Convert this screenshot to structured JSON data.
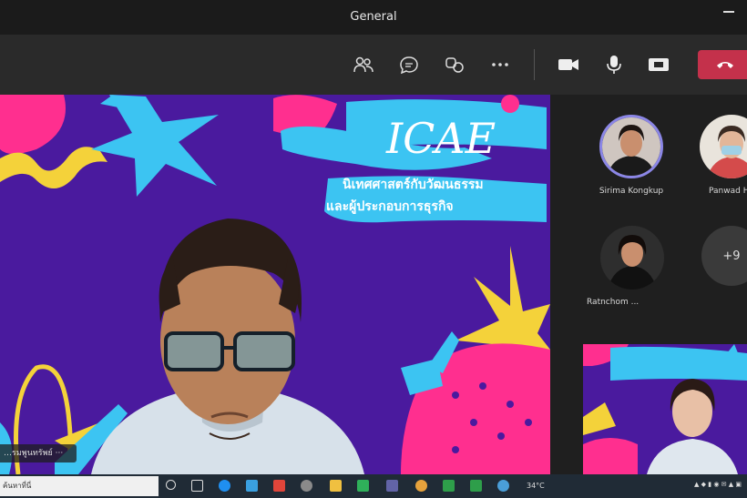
{
  "window": {
    "title": "General"
  },
  "toolbar": {
    "icons": [
      "people-icon",
      "chat-icon",
      "reactions-icon",
      "more-icon",
      "camera-icon",
      "mic-icon",
      "share-icon",
      "hang-up-icon"
    ]
  },
  "stage": {
    "slide_title": "ICAE",
    "slide_line1": "นิเทศศาสตร์กับวัฒนธรรม",
    "slide_line2": "และผู้ประกอบการธุรกิจ",
    "speaker_tag": "…รมพูนทรัพย์ ···",
    "colors": {
      "background": "#4a1a9e",
      "pink": "#ff2f8f",
      "cyan": "#3cc4f2",
      "yellow": "#f4d23a"
    }
  },
  "participants": [
    {
      "name": "Sirima Kongkup"
    },
    {
      "name": "Panwad Ho"
    },
    {
      "name": "Ratnchom ..."
    }
  ],
  "more_count": "+9",
  "taskbar": {
    "search_text": "ค้นหาที่นี่",
    "weather": "34°C"
  }
}
